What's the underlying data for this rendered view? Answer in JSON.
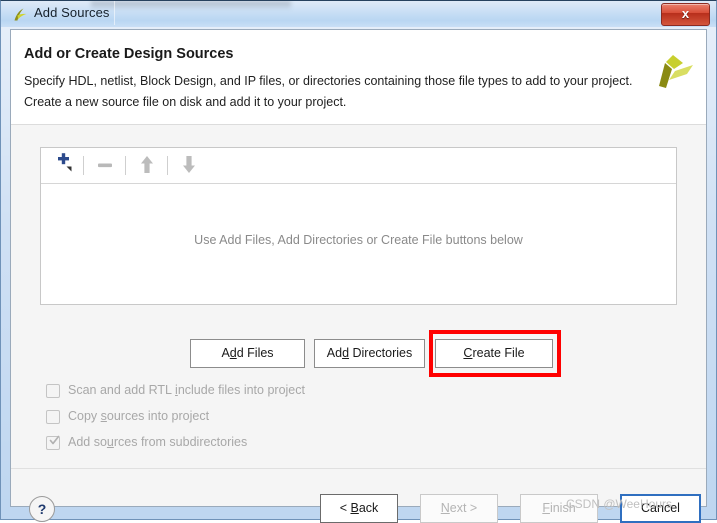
{
  "window": {
    "title": "Add Sources",
    "title_icon": "vivado-leaf-icon",
    "close_label": "x"
  },
  "header": {
    "title": "Add or Create Design Sources",
    "description_line1": "Specify HDL, netlist, Block Design, and IP files, or directories containing those file types to add to your project.",
    "description_line2": "Create a new source file on disk and add it to your project.",
    "brand_logo": "xilinx-pinwheel-logo"
  },
  "list_panel": {
    "toolbar": [
      {
        "name": "add-button",
        "icon": "plus-icon",
        "enabled": true,
        "has_dropdown": true
      },
      {
        "name": "remove-button",
        "icon": "minus-icon",
        "enabled": false
      },
      {
        "name": "move-up-button",
        "icon": "arrow-up-icon",
        "enabled": false
      },
      {
        "name": "move-down-button",
        "icon": "arrow-down-icon",
        "enabled": false
      }
    ],
    "empty_message": "Use Add Files, Add Directories or Create File buttons below"
  },
  "actions": {
    "add_files": {
      "prefix": "A",
      "mnemonic": "",
      "label": "Add Files",
      "pre": "A",
      "mn": "d",
      "post": "d Files"
    },
    "add_directories": {
      "pre": "Ad",
      "mn": "d",
      "post": " Directories"
    },
    "create_file": {
      "pre": "",
      "mn": "C",
      "post": "reate File"
    },
    "highlight_color": "#ff0000",
    "highlighted": "create_file"
  },
  "options": [
    {
      "pre": "Scan and add RTL ",
      "mn": "i",
      "post": "nclude files into project",
      "checked": false,
      "enabled": false
    },
    {
      "pre": "Copy ",
      "mn": "s",
      "post": "ources into project",
      "checked": false,
      "enabled": false
    },
    {
      "pre": "Add so",
      "mn": "u",
      "post": "rces from subdirectories",
      "checked": true,
      "enabled": false
    }
  ],
  "footer": {
    "help_label": "?",
    "back": {
      "pre": "< ",
      "mn": "B",
      "post": "ack",
      "enabled": true,
      "focused": false
    },
    "next": {
      "pre": "",
      "mn": "N",
      "post": "ext >",
      "enabled": false,
      "focused": false
    },
    "finish": {
      "pre": "",
      "mn": "F",
      "post": "inish",
      "enabled": false,
      "focused": false
    },
    "cancel": {
      "pre": "",
      "mn": "",
      "post": "Cancel",
      "enabled": true,
      "focused": true
    }
  },
  "watermark": "CSDN @WeeHours."
}
